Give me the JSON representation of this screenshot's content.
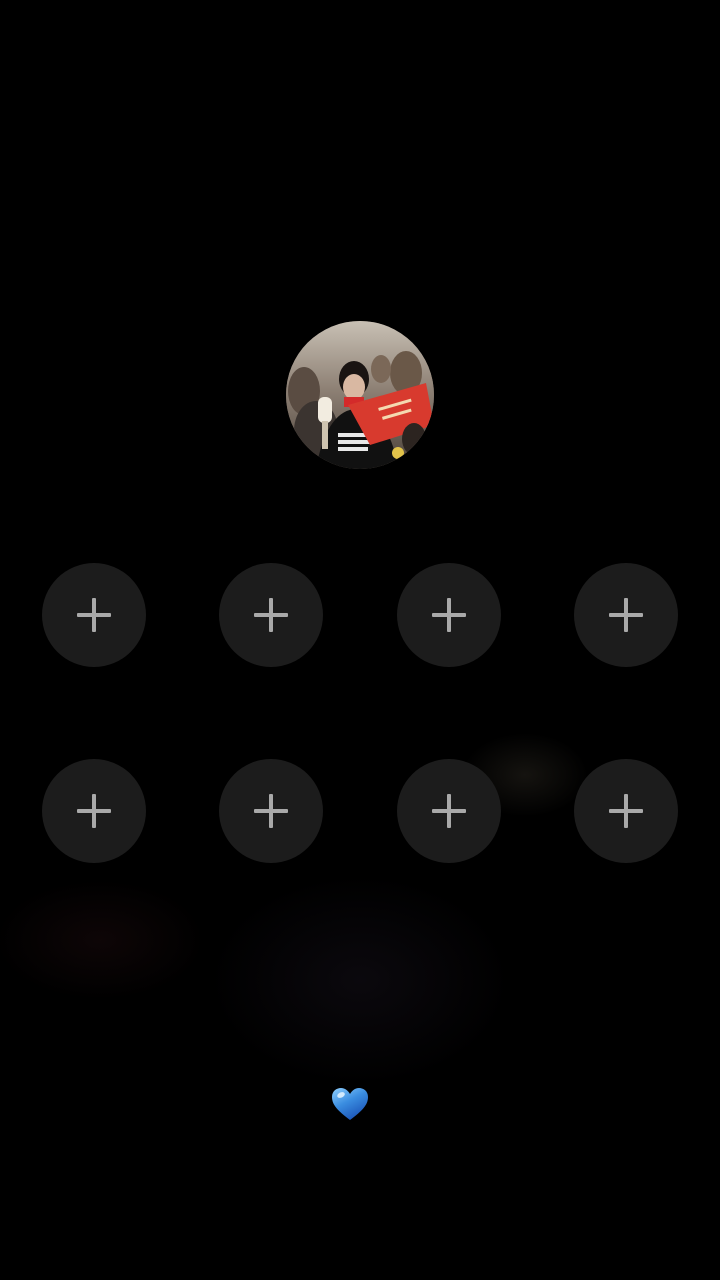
{
  "profile": {
    "avatar_icon": "profile-photo"
  },
  "slots": [
    {
      "icon": "plus-icon",
      "action": "add"
    },
    {
      "icon": "plus-icon",
      "action": "add"
    },
    {
      "icon": "plus-icon",
      "action": "add"
    },
    {
      "icon": "plus-icon",
      "action": "add"
    },
    {
      "icon": "plus-icon",
      "action": "add"
    },
    {
      "icon": "plus-icon",
      "action": "add"
    },
    {
      "icon": "plus-icon",
      "action": "add"
    },
    {
      "icon": "plus-icon",
      "action": "add"
    }
  ],
  "footer": {
    "icon": "blue-heart-icon"
  },
  "colors": {
    "background": "#000000",
    "slot_fill": "#1c1c1c",
    "plus": "#a9a9a9",
    "heart": "#3a8de0"
  }
}
